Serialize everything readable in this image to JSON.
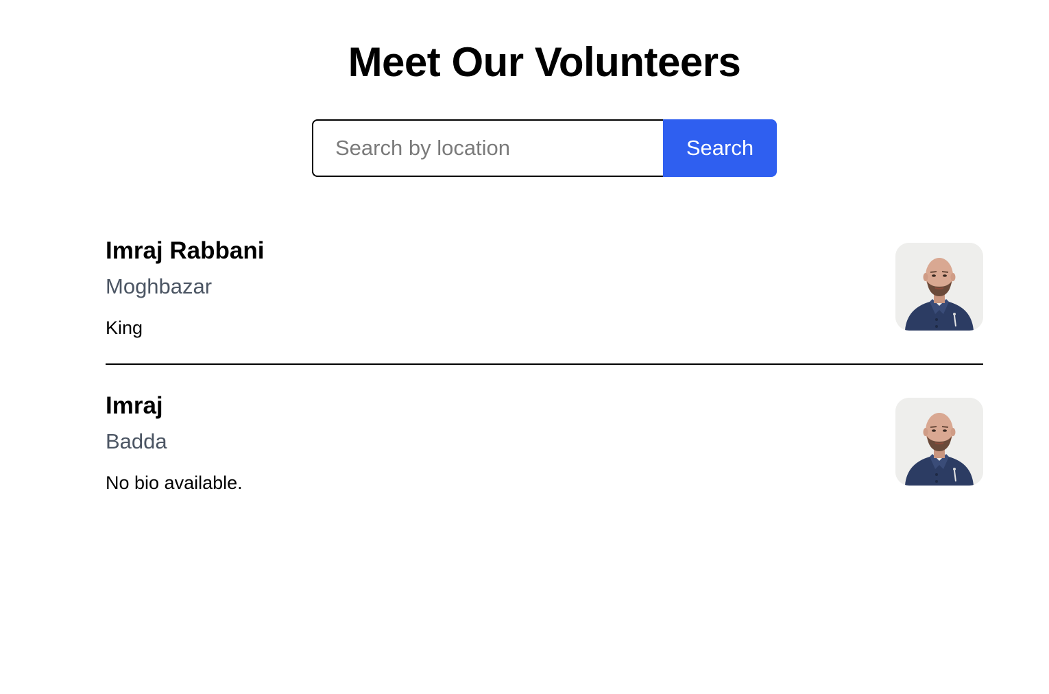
{
  "header": {
    "title": "Meet Our Volunteers"
  },
  "search": {
    "placeholder": "Search by location",
    "value": "",
    "button_label": "Search",
    "button_color": "#2f5ff0"
  },
  "volunteers": [
    {
      "name": "Imraj Rabbani",
      "location": "Moghbazar",
      "bio": "King",
      "avatar_icon": "person-photo"
    },
    {
      "name": "Imraj",
      "location": "Badda",
      "bio": "No bio available.",
      "avatar_icon": "person-photo"
    }
  ],
  "colors": {
    "location_text": "#4b5563",
    "accent": "#2f5ff0"
  }
}
